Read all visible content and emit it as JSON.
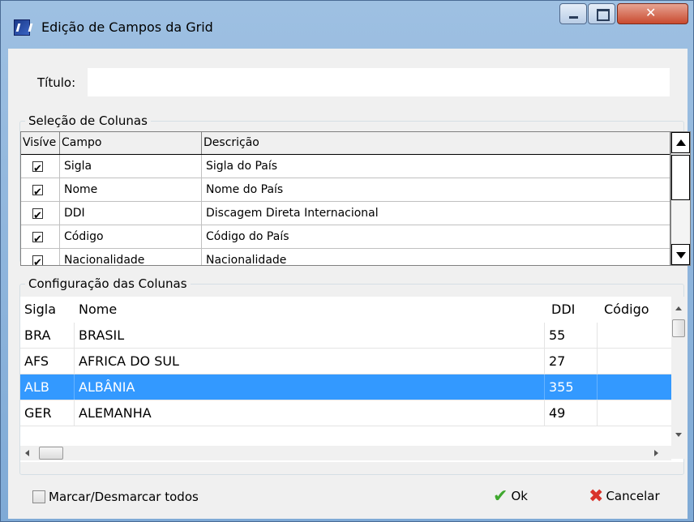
{
  "window": {
    "title": "Edição de Campos da Grid"
  },
  "form": {
    "titulo_label": "Título:",
    "titulo_value": ""
  },
  "selecao": {
    "legend": "Seleção de Colunas",
    "headers": [
      "Visíve",
      "Campo",
      "Descrição"
    ],
    "rows": [
      {
        "visible": true,
        "campo": "Sigla",
        "descricao": "Sigla do País"
      },
      {
        "visible": true,
        "campo": "Nome",
        "descricao": "Nome do País"
      },
      {
        "visible": true,
        "campo": "DDI",
        "descricao": "Discagem Direta Internacional"
      },
      {
        "visible": true,
        "campo": "Código",
        "descricao": "Código do País"
      },
      {
        "visible": true,
        "campo": "Nacionalidade",
        "descricao": "Nacionalidade"
      }
    ]
  },
  "config": {
    "legend": "Configuração das Colunas",
    "headers": [
      "Sigla",
      "Nome",
      "DDI",
      "Código"
    ],
    "rows": [
      {
        "sigla": "BRA",
        "nome": "BRASIL",
        "ddi": "55",
        "codigo": ""
      },
      {
        "sigla": "AFS",
        "nome": "AFRICA DO SUL",
        "ddi": "27",
        "codigo": ""
      },
      {
        "sigla": "ALB",
        "nome": "ALBÂNIA",
        "ddi": "355",
        "codigo": "",
        "selected": true
      },
      {
        "sigla": "GER",
        "nome": "ALEMANHA",
        "ddi": "49",
        "codigo": ""
      }
    ]
  },
  "footer": {
    "mark_all_label": "Marcar/Desmarcar todos",
    "mark_all_checked": false,
    "ok_label": "Ok",
    "cancel_label": "Cancelar"
  },
  "icons": {
    "ok": "green-checkmark-icon",
    "cancel": "red-x-icon",
    "app": "app-logo-icon"
  },
  "colors": {
    "selection": "#3399ff",
    "titlebar": "#8fb5dd",
    "ok": "#3fa82e",
    "cancel": "#d9332b"
  }
}
